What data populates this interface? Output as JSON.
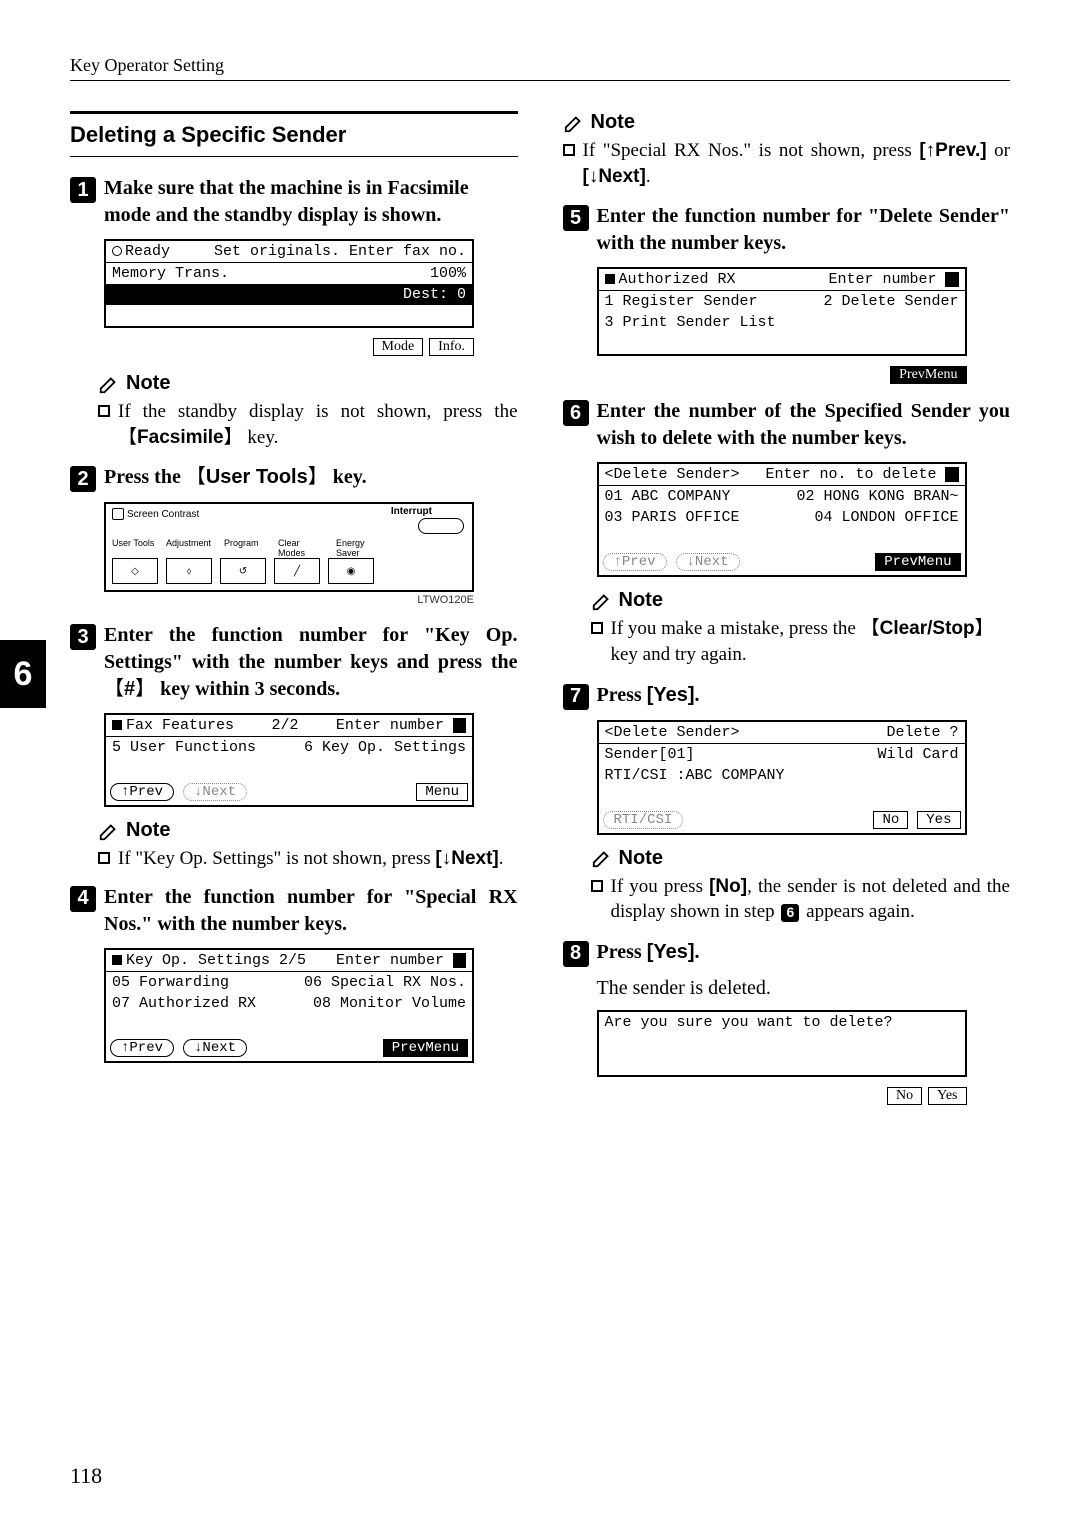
{
  "header": "Key Operator Setting",
  "side_tab": "6",
  "page_number": "118",
  "section_title": "Deleting a Specific Sender",
  "steps": {
    "s1": "Make sure that the machine is in Facsimile mode and the standby display is shown.",
    "s2_a": "Press the ",
    "s2_key": "User Tools",
    "s2_b": " key.",
    "s3_a": "Enter the function number for \"Key Op. Settings\" with the number keys and press the ",
    "s3_key": "#",
    "s3_b": " key within 3 seconds.",
    "s4": "Enter the function number for \"Special RX Nos.\" with the number keys.",
    "s5": "Enter the function number for \"Delete Sender\" with the number keys.",
    "s6": "Enter the number of the Specified Sender you wish to delete with the number keys.",
    "s7": "Press ",
    "s7_btn": "[Yes]",
    "s7_end": ".",
    "s8": "Press ",
    "s8_btn": "[Yes]",
    "s8_end": ".",
    "s8_sub": "The sender is deleted."
  },
  "notes": {
    "n1_a": "If the standby display is not shown, press the ",
    "n1_key": "Facsimile",
    "n1_b": " key.",
    "n3_a": "If \"Key Op. Settings\" is not shown, press ",
    "n3_btn": "[↓Next]",
    "n3_b": ".",
    "nTop_a": "If \"Special RX Nos.\" is not shown, press ",
    "nTop_btn1": "[↑Prev.]",
    "nTop_mid": " or ",
    "nTop_btn2": "[↓Next]",
    "nTop_b": ".",
    "n6_a": "If you make a mistake, press the ",
    "n6_key": "Clear/Stop",
    "n6_b": " key and try again.",
    "n7_a": "If you press ",
    "n7_btn": "[No]",
    "n7_b": ", the sender is not deleted and the display shown in step ",
    "n7_ref": "6",
    "n7_c": " appears again."
  },
  "lcd1": {
    "r1a": "Ready",
    "r1b": "Set originals. Enter fax no.",
    "r2a": "Memory Trans.",
    "r2b": "100%",
    "r3a": "",
    "r3b": "Dest:  0",
    "btn1": "Mode",
    "btn2": "Info."
  },
  "panel": {
    "sc": "Screen Contrast",
    "interrupt": "Interrupt",
    "l1": "User Tools",
    "l2": "Adjustment",
    "l3": "Program",
    "l4": "Clear Modes",
    "l5": "Energy Saver",
    "caption": "LTWO120E"
  },
  "lcd3": {
    "h1": "Fax Features",
    "h2": "2/2",
    "h3": "Enter number",
    "b1": "5 User Functions",
    "b2": "6 Key Op. Settings",
    "f1": "↑Prev",
    "f2": "↓Next",
    "f3": "Menu"
  },
  "lcd4": {
    "h1": "Key Op. Settings 2/5",
    "h3": "Enter number",
    "b1": "05 Forwarding",
    "b2": "06 Special RX Nos.",
    "b3": "07 Authorized RX",
    "b4": "08 Monitor Volume",
    "f1": "↑Prev",
    "f2": "↓Next",
    "f3": "PrevMenu"
  },
  "lcd5": {
    "h1": "Authorized RX",
    "h3": "Enter number",
    "b1": "1 Register Sender",
    "b2": "2 Delete Sender",
    "b3": "3 Print Sender List",
    "f3": "PrevMenu"
  },
  "lcd6": {
    "h1": "<Delete Sender>",
    "h3": "Enter no. to delete",
    "b1": "01 ABC COMPANY",
    "b2": "02 HONG KONG BRAN~",
    "b3": "03 PARIS OFFICE",
    "b4": "04 LONDON OFFICE",
    "f1": "↑Prev",
    "f2": "↓Next",
    "f3": "PrevMenu"
  },
  "lcd7": {
    "h1": "<Delete Sender>",
    "h3": "Delete ?",
    "b1": "Sender[01]",
    "b2": "Wild Card",
    "b3": "RTI/CSI :ABC COMPANY",
    "f1": "RTI/CSI",
    "f2": "No",
    "f3": "Yes"
  },
  "lcd8": {
    "b1": "Are you sure you want to delete?",
    "f2": "No",
    "f3": "Yes"
  },
  "note_label": "Note"
}
